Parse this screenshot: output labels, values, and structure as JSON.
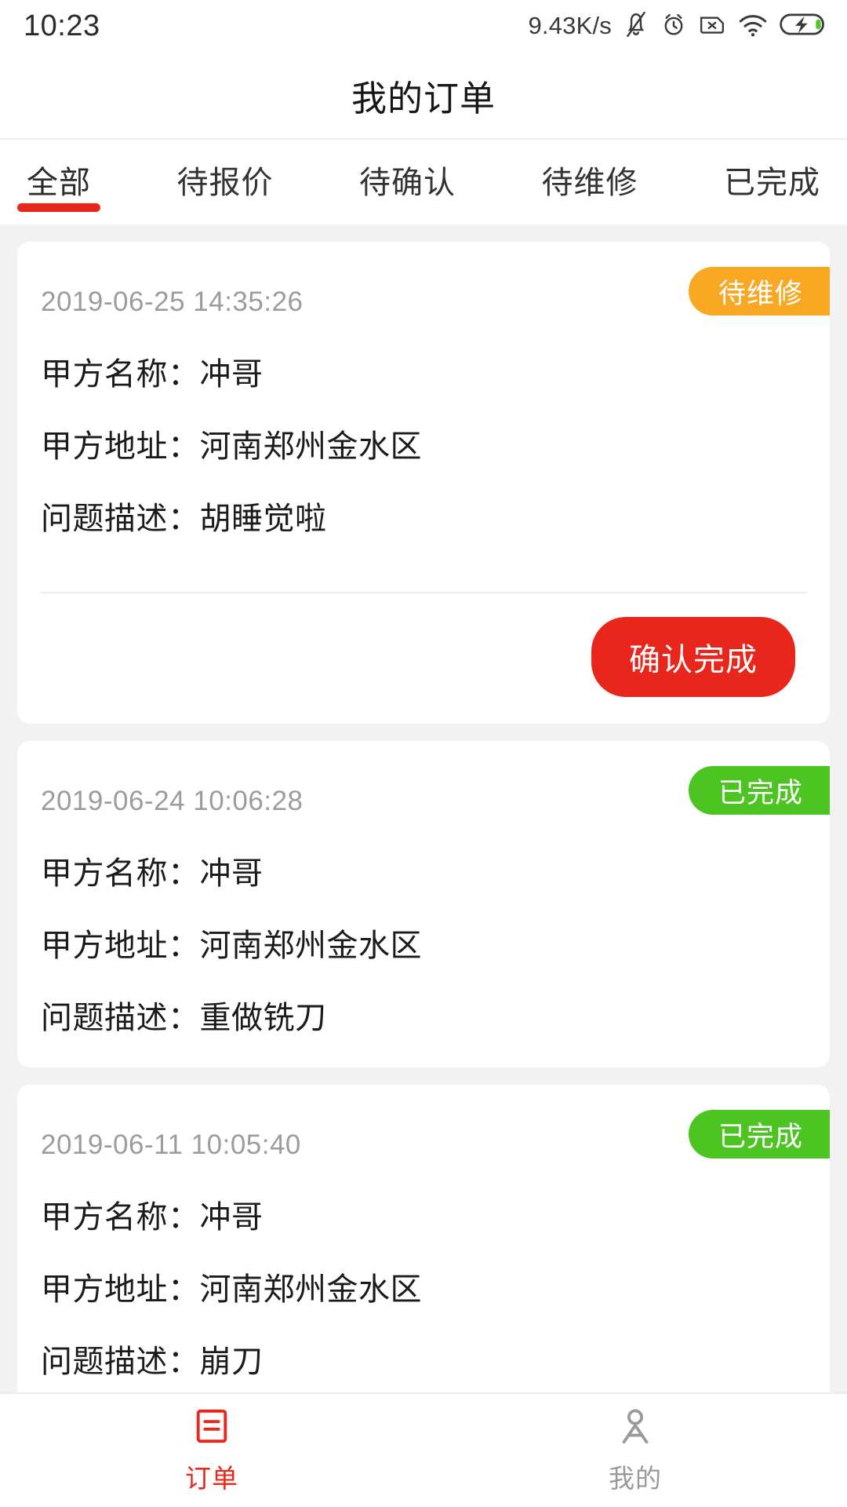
{
  "status_bar": {
    "time": "10:23",
    "network_speed": "9.43K/s",
    "icons": [
      "bell-muted-icon",
      "alarm-clock-icon",
      "sim-card-disabled-icon",
      "wifi-icon",
      "battery-charging-icon"
    ]
  },
  "header": {
    "title": "我的订单"
  },
  "tabs": {
    "items": [
      {
        "label": "全部",
        "active": true
      },
      {
        "label": "待报价",
        "active": false
      },
      {
        "label": "待确认",
        "active": false
      },
      {
        "label": "待维修",
        "active": false
      },
      {
        "label": "已完成",
        "active": false
      }
    ],
    "active_index": 0,
    "indicator_color": "#e8261b"
  },
  "orders": [
    {
      "date": "2019-06-25 14:35:26",
      "status_label": "待维修",
      "status_color": "#f9a824",
      "client_name": "甲方名称：冲哥",
      "client_address": "甲方地址：河南郑州金水区",
      "problem": "问题描述：胡睡觉啦",
      "action_label": "确认完成",
      "action_color": "#e8261b",
      "has_action": true
    },
    {
      "date": "2019-06-24 10:06:28",
      "status_label": "已完成",
      "status_color": "#4cc422",
      "client_name": "甲方名称：冲哥",
      "client_address": "甲方地址：河南郑州金水区",
      "problem": "问题描述：重做铣刀",
      "action_label": "",
      "action_color": "",
      "has_action": false
    },
    {
      "date": "2019-06-11 10:05:40",
      "status_label": "已完成",
      "status_color": "#4cc422",
      "client_name": "甲方名称：冲哥",
      "client_address": "甲方地址：河南郑州金水区",
      "problem": "问题描述：崩刀",
      "action_label": "",
      "action_color": "",
      "has_action": false
    }
  ],
  "bottom_nav": {
    "items": [
      {
        "label": "订单",
        "icon": "order-list-icon",
        "active": true
      },
      {
        "label": "我的",
        "icon": "user-profile-icon",
        "active": false
      }
    ],
    "active_color": "#e8261b",
    "inactive_color": "#9a9a9a"
  }
}
